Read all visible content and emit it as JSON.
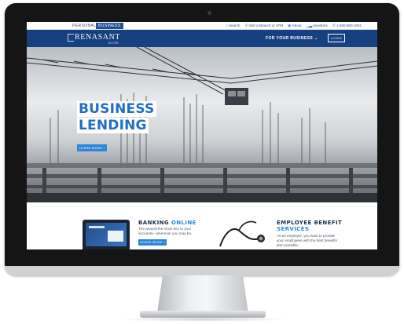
{
  "utility_bar": {
    "tabs": [
      {
        "label": "PERSONAL",
        "active": false
      },
      {
        "label": "BUSINESS",
        "active": true
      }
    ],
    "links": [
      {
        "icon": "search-icon",
        "label": "Search"
      },
      {
        "icon": "location-pin-icon",
        "label": "Visit a Branch or ATM"
      },
      {
        "icon": "info-icon",
        "label": "About"
      },
      {
        "icon": "chart-icon",
        "label": "Investors"
      },
      {
        "icon": "phone-icon",
        "label": "1.800.680.1601"
      }
    ]
  },
  "nav": {
    "logo_name": "RENASANT",
    "logo_sub": "BANK",
    "menu_label": "FOR YOUR BUSINESS ⌄",
    "login_label": "LOGIN"
  },
  "hero": {
    "title_line1": "BUSINESS",
    "title_line2": "LENDING",
    "cta_label": "LEARN MORE ›"
  },
  "promos": [
    {
      "title_plain": "BANKING",
      "title_accent": "ONLINE",
      "text": "The around-the-clock key to your accounts—wherever you may be.",
      "cta_label": "LEARN MORE ›"
    },
    {
      "title_plain": "EMPLOYEE BENEFIT",
      "title_accent": "SERVICES",
      "text": "As an employer, you want to provide your employees with the best benefits plan possible."
    }
  ],
  "colors": {
    "brand_navy": "#16407f",
    "accent_blue": "#2d86d8",
    "title_blue": "#1f6ec7"
  }
}
